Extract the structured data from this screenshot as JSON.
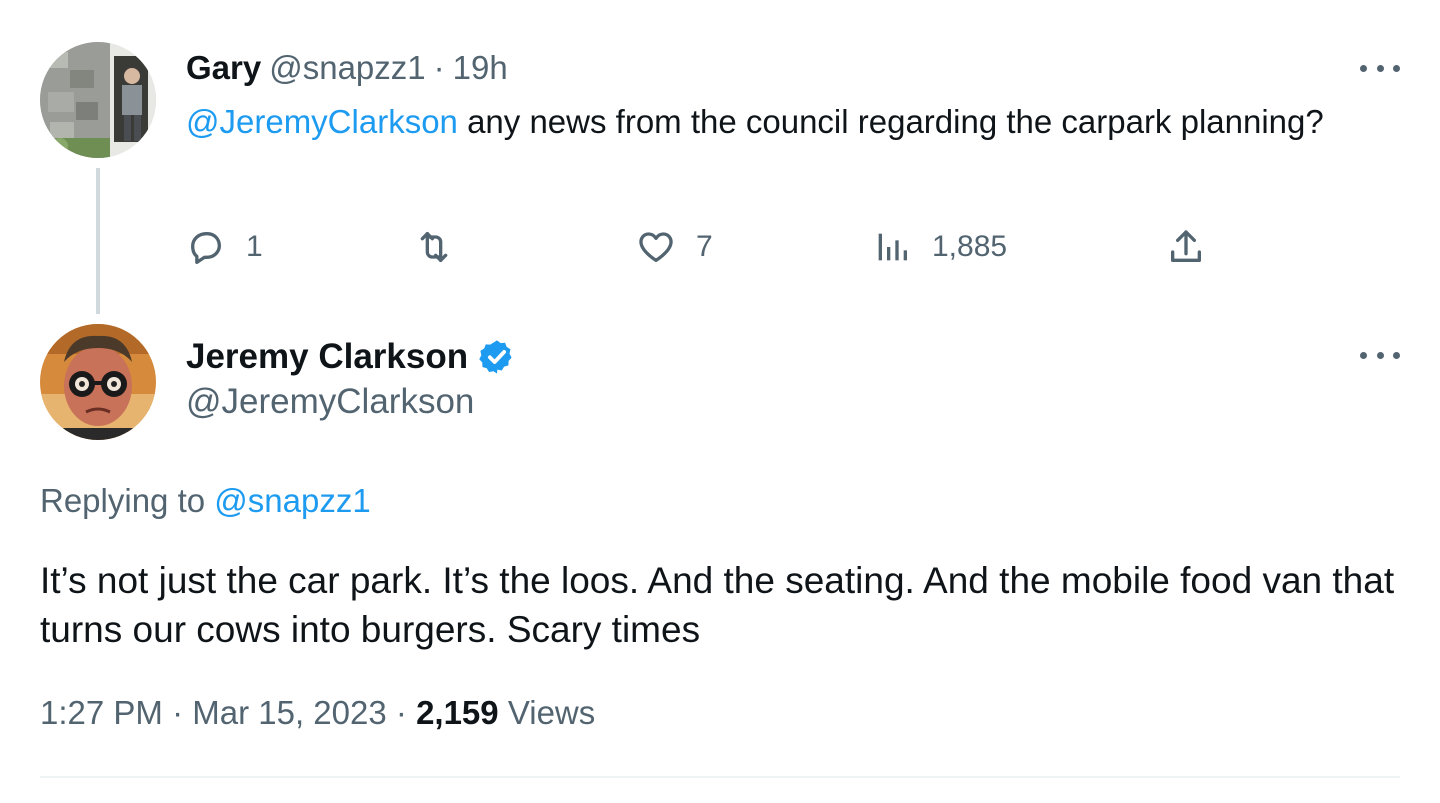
{
  "parent_tweet": {
    "author_name": "Gary",
    "author_handle": "@snapzz1",
    "separator": "·",
    "time_ago": "19h",
    "mention": "@JeremyClarkson",
    "text": " any news from the council  regarding the carpark planning?",
    "counts": {
      "replies": "1",
      "retweets": "",
      "likes": "7",
      "views": "1,885"
    }
  },
  "main_tweet": {
    "author_name": "Jeremy Clarkson",
    "author_handle": "@JeremyClarkson",
    "verified": true,
    "replying_prefix": "Replying to",
    "replying_to": "@snapzz1",
    "text": "It’s not just the car park. It’s the loos. And the seating. And the mobile food van that turns our cows into burgers. Scary times",
    "time": "1:27 PM",
    "separator": "·",
    "date": "Mar 15, 2023",
    "views_count": "2,159",
    "views_label": "Views"
  },
  "icons": {
    "reply": "reply-icon",
    "retweet": "retweet-icon",
    "like": "heart-icon",
    "views": "views-chart-icon",
    "share": "share-icon",
    "more": "more-dots-icon",
    "verified": "verified-badge-icon"
  },
  "colors": {
    "link": "#1d9bf0",
    "text": "#0f1419",
    "muted": "#536471",
    "thread_line": "#cfd9de"
  }
}
